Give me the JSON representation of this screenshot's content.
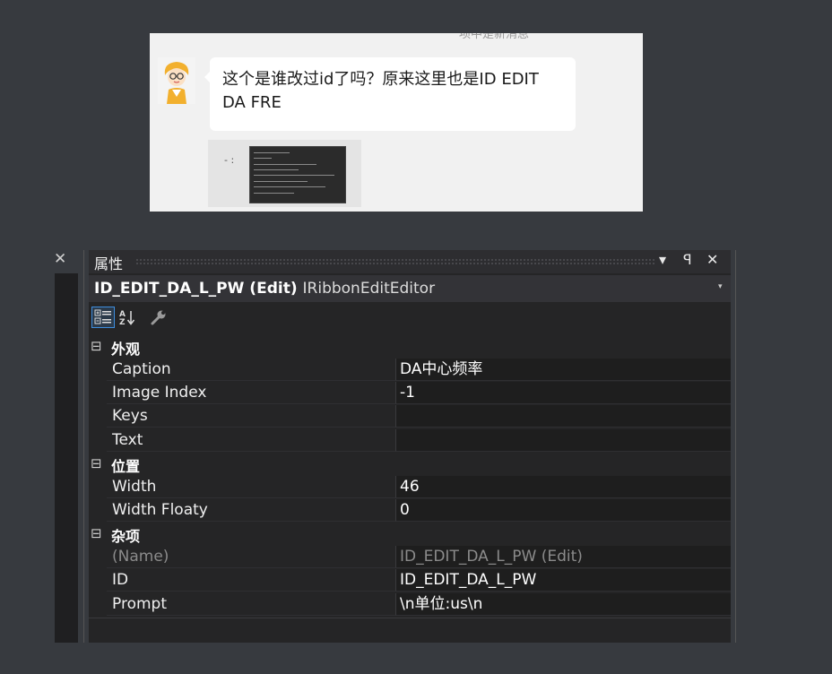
{
  "chat": {
    "cut_text": "项中是新消息",
    "message": "这个是谁改过id了吗？原来这里也是ID EDIT DA FRE",
    "thumb_text": "- :"
  },
  "left_close": "✕",
  "panel": {
    "title": "属性",
    "buttons": {
      "dropdown": "▾",
      "pin": "ꟼ",
      "close": "✕"
    },
    "object": {
      "name": "ID_EDIT_DA_L_PW (Edit)",
      "type": "IRibbonEditEditor",
      "dropdown": "▾"
    },
    "toolbar": {
      "categorized_icon": "categorized-icon",
      "alphabetical_icon": "alphabetical-icon",
      "property_pages_icon": "wrench-icon"
    },
    "categories": [
      {
        "toggle": "⊟",
        "name": "外观",
        "props": [
          {
            "name": "Caption",
            "value": "DA中心频率"
          },
          {
            "name": "Image Index",
            "value": "-1"
          },
          {
            "name": "Keys",
            "value": ""
          },
          {
            "name": "Text",
            "value": ""
          }
        ]
      },
      {
        "toggle": "⊟",
        "name": "位置",
        "props": [
          {
            "name": "Width",
            "value": "46"
          },
          {
            "name": "Width Floaty",
            "value": "0"
          }
        ]
      },
      {
        "toggle": "⊟",
        "name": "杂项",
        "props": [
          {
            "name": "(Name)",
            "value": "ID_EDIT_DA_L_PW (Edit)",
            "readonly": true
          },
          {
            "name": "ID",
            "value": "ID_EDIT_DA_L_PW"
          },
          {
            "name": "Prompt",
            "value": "\\n单位:us\\n"
          }
        ]
      }
    ]
  }
}
